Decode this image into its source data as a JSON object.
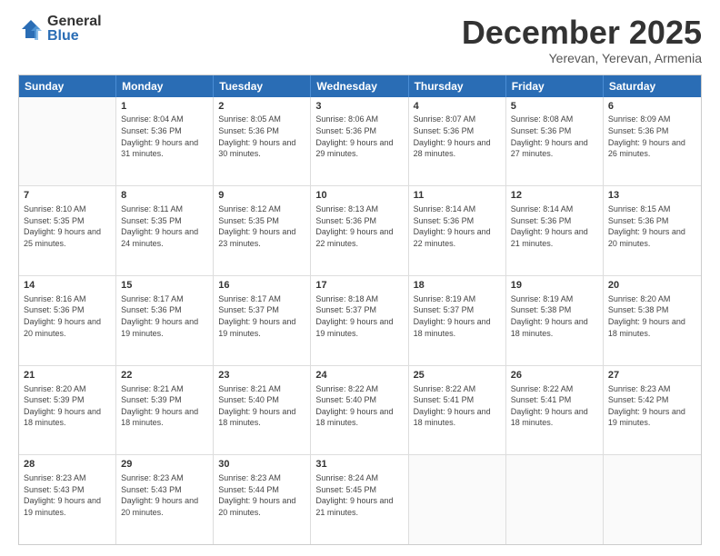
{
  "logo": {
    "general": "General",
    "blue": "Blue"
  },
  "title": "December 2025",
  "subtitle": "Yerevan, Yerevan, Armenia",
  "header": {
    "days": [
      "Sunday",
      "Monday",
      "Tuesday",
      "Wednesday",
      "Thursday",
      "Friday",
      "Saturday"
    ]
  },
  "weeks": [
    [
      {
        "day": "",
        "empty": true
      },
      {
        "day": "1",
        "sunrise": "8:04 AM",
        "sunset": "5:36 PM",
        "daylight": "9 hours and 31 minutes."
      },
      {
        "day": "2",
        "sunrise": "8:05 AM",
        "sunset": "5:36 PM",
        "daylight": "9 hours and 30 minutes."
      },
      {
        "day": "3",
        "sunrise": "8:06 AM",
        "sunset": "5:36 PM",
        "daylight": "9 hours and 29 minutes."
      },
      {
        "day": "4",
        "sunrise": "8:07 AM",
        "sunset": "5:36 PM",
        "daylight": "9 hours and 28 minutes."
      },
      {
        "day": "5",
        "sunrise": "8:08 AM",
        "sunset": "5:36 PM",
        "daylight": "9 hours and 27 minutes."
      },
      {
        "day": "6",
        "sunrise": "8:09 AM",
        "sunset": "5:36 PM",
        "daylight": "9 hours and 26 minutes."
      }
    ],
    [
      {
        "day": "7",
        "sunrise": "8:10 AM",
        "sunset": "5:35 PM",
        "daylight": "9 hours and 25 minutes."
      },
      {
        "day": "8",
        "sunrise": "8:11 AM",
        "sunset": "5:35 PM",
        "daylight": "9 hours and 24 minutes."
      },
      {
        "day": "9",
        "sunrise": "8:12 AM",
        "sunset": "5:35 PM",
        "daylight": "9 hours and 23 minutes."
      },
      {
        "day": "10",
        "sunrise": "8:13 AM",
        "sunset": "5:36 PM",
        "daylight": "9 hours and 22 minutes."
      },
      {
        "day": "11",
        "sunrise": "8:14 AM",
        "sunset": "5:36 PM",
        "daylight": "9 hours and 22 minutes."
      },
      {
        "day": "12",
        "sunrise": "8:14 AM",
        "sunset": "5:36 PM",
        "daylight": "9 hours and 21 minutes."
      },
      {
        "day": "13",
        "sunrise": "8:15 AM",
        "sunset": "5:36 PM",
        "daylight": "9 hours and 20 minutes."
      }
    ],
    [
      {
        "day": "14",
        "sunrise": "8:16 AM",
        "sunset": "5:36 PM",
        "daylight": "9 hours and 20 minutes."
      },
      {
        "day": "15",
        "sunrise": "8:17 AM",
        "sunset": "5:36 PM",
        "daylight": "9 hours and 19 minutes."
      },
      {
        "day": "16",
        "sunrise": "8:17 AM",
        "sunset": "5:37 PM",
        "daylight": "9 hours and 19 minutes."
      },
      {
        "day": "17",
        "sunrise": "8:18 AM",
        "sunset": "5:37 PM",
        "daylight": "9 hours and 19 minutes."
      },
      {
        "day": "18",
        "sunrise": "8:19 AM",
        "sunset": "5:37 PM",
        "daylight": "9 hours and 18 minutes."
      },
      {
        "day": "19",
        "sunrise": "8:19 AM",
        "sunset": "5:38 PM",
        "daylight": "9 hours and 18 minutes."
      },
      {
        "day": "20",
        "sunrise": "8:20 AM",
        "sunset": "5:38 PM",
        "daylight": "9 hours and 18 minutes."
      }
    ],
    [
      {
        "day": "21",
        "sunrise": "8:20 AM",
        "sunset": "5:39 PM",
        "daylight": "9 hours and 18 minutes."
      },
      {
        "day": "22",
        "sunrise": "8:21 AM",
        "sunset": "5:39 PM",
        "daylight": "9 hours and 18 minutes."
      },
      {
        "day": "23",
        "sunrise": "8:21 AM",
        "sunset": "5:40 PM",
        "daylight": "9 hours and 18 minutes."
      },
      {
        "day": "24",
        "sunrise": "8:22 AM",
        "sunset": "5:40 PM",
        "daylight": "9 hours and 18 minutes."
      },
      {
        "day": "25",
        "sunrise": "8:22 AM",
        "sunset": "5:41 PM",
        "daylight": "9 hours and 18 minutes."
      },
      {
        "day": "26",
        "sunrise": "8:22 AM",
        "sunset": "5:41 PM",
        "daylight": "9 hours and 18 minutes."
      },
      {
        "day": "27",
        "sunrise": "8:23 AM",
        "sunset": "5:42 PM",
        "daylight": "9 hours and 19 minutes."
      }
    ],
    [
      {
        "day": "28",
        "sunrise": "8:23 AM",
        "sunset": "5:43 PM",
        "daylight": "9 hours and 19 minutes."
      },
      {
        "day": "29",
        "sunrise": "8:23 AM",
        "sunset": "5:43 PM",
        "daylight": "9 hours and 20 minutes."
      },
      {
        "day": "30",
        "sunrise": "8:23 AM",
        "sunset": "5:44 PM",
        "daylight": "9 hours and 20 minutes."
      },
      {
        "day": "31",
        "sunrise": "8:24 AM",
        "sunset": "5:45 PM",
        "daylight": "9 hours and 21 minutes."
      },
      {
        "day": "",
        "empty": true
      },
      {
        "day": "",
        "empty": true
      },
      {
        "day": "",
        "empty": true
      }
    ]
  ]
}
